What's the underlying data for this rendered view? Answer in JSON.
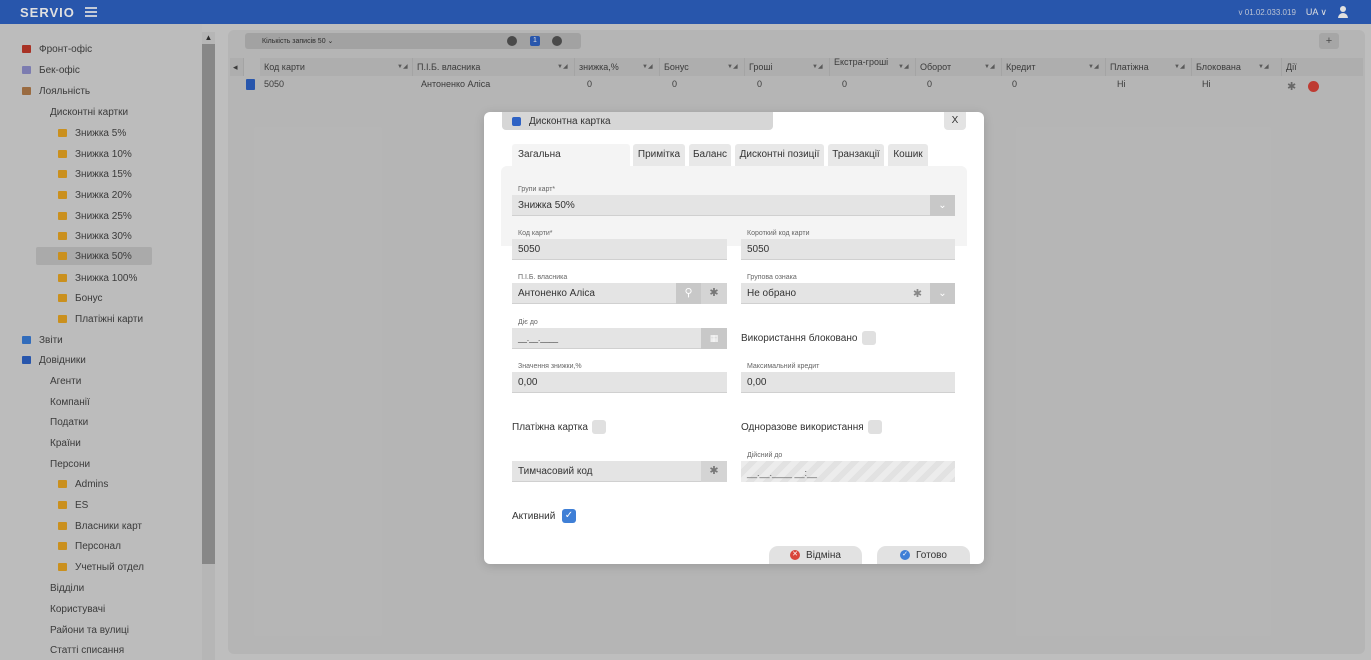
{
  "topbar": {
    "brand": "SERVIO",
    "version": "v 01.02.033.019",
    "lang": "UA ∨"
  },
  "sidebar": {
    "items": [
      {
        "label": "Фронт-офіс"
      },
      {
        "label": "Бек-офіс"
      },
      {
        "label": "Лояльність"
      },
      {
        "label": "Дисконтні картки"
      },
      {
        "label": "Знижка 5%"
      },
      {
        "label": "Знижка 10%"
      },
      {
        "label": "Знижка 15%"
      },
      {
        "label": "Знижка 20%"
      },
      {
        "label": "Знижка 25%"
      },
      {
        "label": "Знижка 30%"
      },
      {
        "label": "Знижка 50%"
      },
      {
        "label": "Знижка 100%"
      },
      {
        "label": "Бонус"
      },
      {
        "label": "Платіжні карти"
      },
      {
        "label": "Звіти"
      },
      {
        "label": "Довідники"
      },
      {
        "label": "Агенти"
      },
      {
        "label": "Компанії"
      },
      {
        "label": "Податки"
      },
      {
        "label": "Країни"
      },
      {
        "label": "Персони"
      },
      {
        "label": "Admins"
      },
      {
        "label": "ES"
      },
      {
        "label": "Власники карт"
      },
      {
        "label": "Персонал"
      },
      {
        "label": "Учетный отдел"
      },
      {
        "label": "Відділи"
      },
      {
        "label": "Користувачі"
      },
      {
        "label": "Райони та вулиці"
      },
      {
        "label": "Статті списання"
      }
    ]
  },
  "toolbar": {
    "records_label": "Кількість записів 50 ⌄",
    "page": "1",
    "add": "+"
  },
  "grid": {
    "columns": [
      "Код карти",
      "П.І.Б. власника",
      "знижка,%",
      "Бонус",
      "Гроші",
      "Екстра-гроші",
      "Оборот",
      "Кредит",
      "Платіжна",
      "Блокована",
      "Дії"
    ],
    "row": {
      "code": "5050",
      "owner": "Антоненко Аліса",
      "discount": "0",
      "bonus": "0",
      "money": "0",
      "extra": "0",
      "turnover": "0",
      "credit": "0",
      "payment": "Ні",
      "blocked": "Ні"
    }
  },
  "modal": {
    "title": "Дисконтна картка",
    "close": "X",
    "tabs": [
      "Загальна",
      "Примітка",
      "Баланс",
      "Дисконтні позиції",
      "Транзакції",
      "Кошик"
    ],
    "card_group_label": "Групи карт*",
    "card_group_value": "Знижка 50%",
    "card_code_label": "Код карти*",
    "card_code_value": "5050",
    "short_code_label": "Короткий код карти",
    "short_code_value": "5050",
    "owner_label": "П.І.Б. власника",
    "owner_value": "Антоненко Аліса",
    "group_attr_label": "Групова ознака",
    "group_attr_value": "Не обрано",
    "valid_to_label": "Діє до",
    "valid_to_value": "__.__.____",
    "usage_blocked_label": "Використання блоковано",
    "discount_value_label": "Значення знижки,%",
    "discount_value": "0,00",
    "max_credit_label": "Максимальний кредит",
    "max_credit_value": "0,00",
    "payment_card_label": "Платіжна картка",
    "one_time_label": "Одноразове використання",
    "temp_code_placeholder": "Тимчасовий код",
    "valid_until_label": "Дійсний до",
    "valid_until_value": "__.__.____ __:__",
    "active_label": "Активний",
    "cancel_label": "Відміна",
    "ok_label": "Готово"
  }
}
